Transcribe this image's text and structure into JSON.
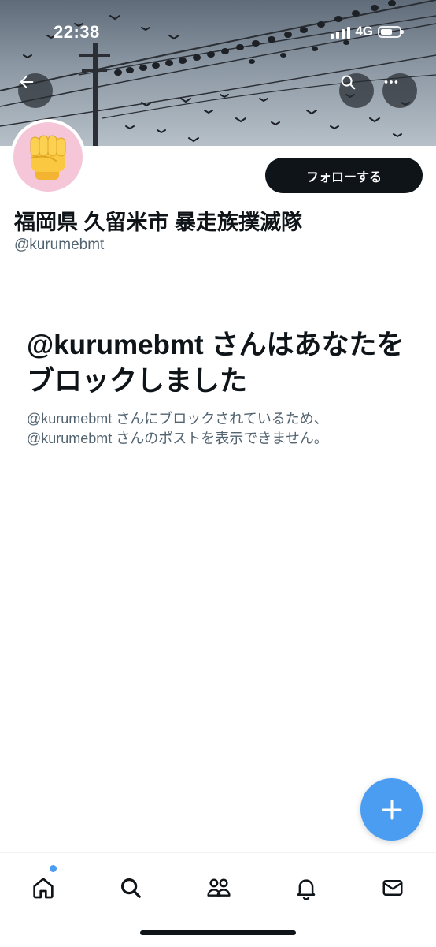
{
  "status_bar": {
    "time": "22:38",
    "network": "4G"
  },
  "header": {
    "back_icon": "arrow-left-icon",
    "search_icon": "search-icon",
    "more_icon": "more-horizontal-icon"
  },
  "profile": {
    "avatar_emoji": "✊",
    "display_name": "福岡県 久留米市 暴走族撲滅隊",
    "handle": "@kurumebmt",
    "follow_label": "フォローする"
  },
  "blocked": {
    "title": "@kurumebmt さんはあなたをブロックしました",
    "description": "@kurumebmt さんにブロックされているため、@kurumebmt さんのポストを表示できません。"
  },
  "fab": {
    "icon": "plus-icon"
  },
  "tabbar": {
    "items": [
      {
        "name": "home",
        "icon": "home-icon",
        "has_badge": true
      },
      {
        "name": "search",
        "icon": "search-icon"
      },
      {
        "name": "communities",
        "icon": "people-icon"
      },
      {
        "name": "notifications",
        "icon": "bell-icon"
      },
      {
        "name": "messages",
        "icon": "mail-icon"
      }
    ]
  },
  "colors": {
    "accent": "#4a9df0",
    "text_primary": "#0f1419",
    "text_secondary": "#536471",
    "avatar_bg": "#f4c6d7"
  }
}
